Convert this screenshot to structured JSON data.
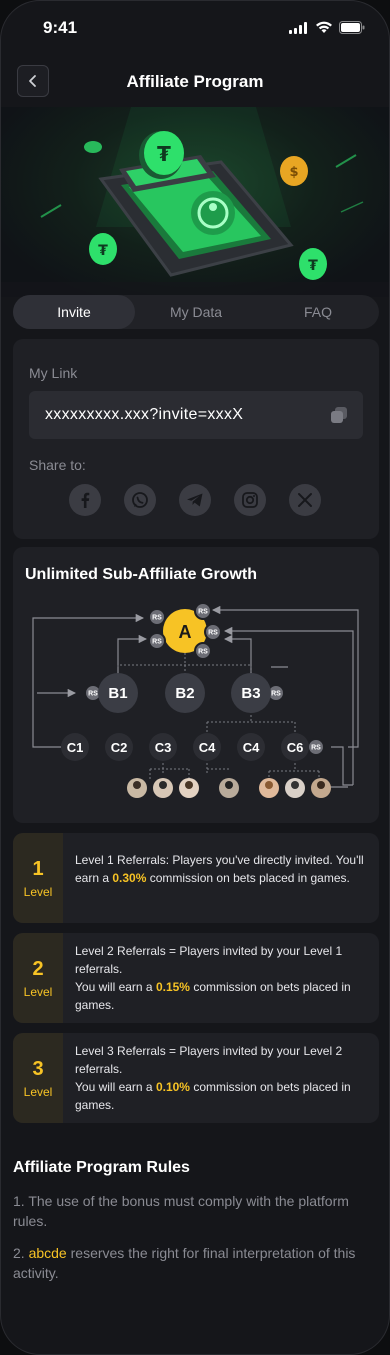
{
  "status_bar": {
    "time": "9:41"
  },
  "header": {
    "title": "Affiliate Program"
  },
  "tabs": [
    {
      "label": "Invite",
      "active": true
    },
    {
      "label": "My Data",
      "active": false
    },
    {
      "label": "FAQ",
      "active": false
    }
  ],
  "link_card": {
    "label": "My Link",
    "link_value": "xxxxxxxxx.xxx?invite=xxxX",
    "share_label": "Share to:",
    "socials": [
      "facebook-icon",
      "whatsapp-icon",
      "telegram-icon",
      "instagram-icon",
      "x-icon"
    ]
  },
  "tree": {
    "title": "Unlimited Sub-Affiliate Growth",
    "root": "A",
    "level_b": [
      "B1",
      "B2",
      "B3"
    ],
    "level_c": [
      "C1",
      "C2",
      "C3",
      "C4",
      "C4",
      "C6"
    ],
    "token": "RS"
  },
  "levels": [
    {
      "num": "1",
      "word": "Level",
      "text_before": "Level 1 Referrals: Players you've directly invited. You'll earn a ",
      "percent": "0.30%",
      "text_after": " commission on bets placed in games."
    },
    {
      "num": "2",
      "word": "Level",
      "text_before": "Level 2 Referrals = Players invited by your Level 1 referrals.\nYou will earn a ",
      "percent": "0.15%",
      "text_after": " commission on bets placed in games."
    },
    {
      "num": "3",
      "word": "Level",
      "text_before": "Level 3 Referrals = Players invited by your Level 2 referrals.\nYou will earn a ",
      "percent": "0.10%",
      "text_after": " commission on bets placed in games."
    }
  ],
  "rules": {
    "title": "Affiliate Program Rules",
    "rule1": "1. The use of the bonus must comply with the platform rules.",
    "rule2_prefix": "2. ",
    "rule2_brand": "abcde",
    "rule2_suffix": " reserves the right for final interpretation of this activity."
  },
  "colors": {
    "accent": "#f7c325",
    "green": "#2ee06b",
    "bg": "#15161a",
    "card": "#1f2025"
  }
}
